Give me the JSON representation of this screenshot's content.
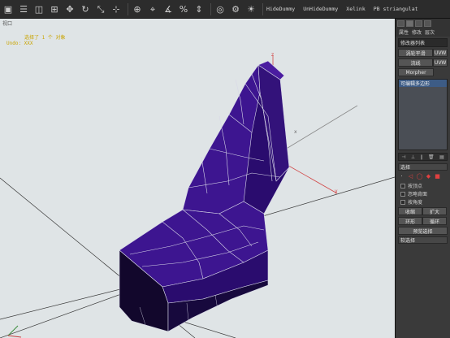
{
  "toolbar": {
    "items": [
      "HideDummy",
      "UnHideDummy",
      "Xelink",
      "PB striangulat"
    ]
  },
  "viewport": {
    "name": "视口",
    "selected_text": "选择了 1 个 对象",
    "undo_text": "Undo:  XXX"
  },
  "panel": {
    "tabs": [
      "属性",
      "修改",
      "层次"
    ],
    "modifier_list_label": "修改器列表",
    "btn_turbosmooth": "涡轮平滑",
    "btn_uvw": "UVW",
    "btn_fillet": "流线",
    "btn_uvw2": "UVW",
    "btn_morpher": "Morpher",
    "stack_item": "可编辑多边形",
    "rollout_select": "选择",
    "chk_by_vertex": "按顶点",
    "chk_ignore_back": "忽略背面",
    "chk_by_angle": "按角度",
    "btn_shrink": "收缩",
    "btn_grow": "扩大",
    "btn_ring": "环形",
    "btn_loop": "循环",
    "btn_preview": "预览选择",
    "rollout_soft": "软选择"
  },
  "colors": {
    "seat_top": "#3d1590",
    "seat_side": "#2a0c6e",
    "seat_dark": "#17093d",
    "seat_front": "#12072c",
    "wire": "#d8d8e8",
    "viewport_bg": "#dfe4e6",
    "gizmo_red": "#d24848",
    "text_yellow": "#c9a400"
  }
}
